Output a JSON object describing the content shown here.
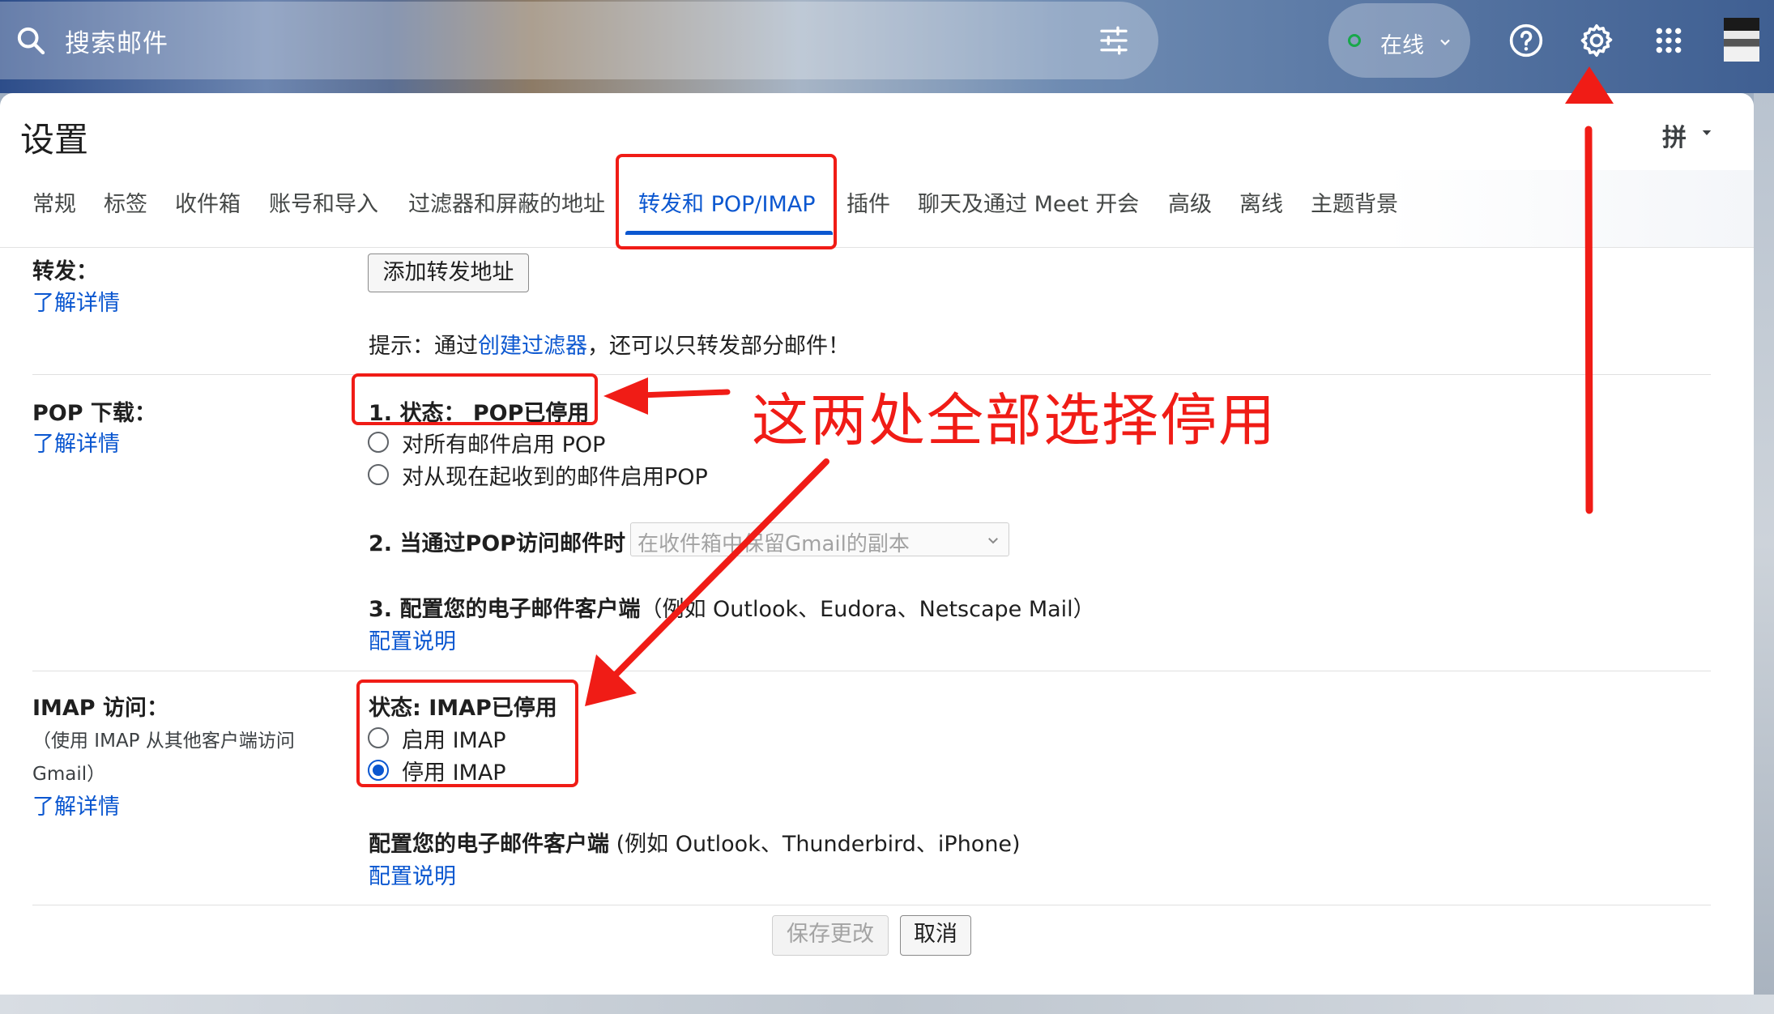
{
  "search": {
    "placeholder": "搜索邮件"
  },
  "status": {
    "label": "在线"
  },
  "header": {
    "title": "设置",
    "ime": "拼"
  },
  "tabs": [
    {
      "label": "常规"
    },
    {
      "label": "标签"
    },
    {
      "label": "收件箱"
    },
    {
      "label": "账号和导入"
    },
    {
      "label": "过滤器和屏蔽的地址"
    },
    {
      "label": "转发和 POP/IMAP",
      "active": true
    },
    {
      "label": "插件"
    },
    {
      "label": "聊天及通过 Meet 开会"
    },
    {
      "label": "高级"
    },
    {
      "label": "离线"
    },
    {
      "label": "主题背景"
    }
  ],
  "forwarding": {
    "label": "转发：",
    "learn_more": "了解详情",
    "add_button": "添加转发地址",
    "tip_prefix": "提示：通过",
    "tip_link": "创建过滤器",
    "tip_suffix": "，还可以只转发部分邮件！"
  },
  "pop": {
    "label": "POP 下载：",
    "learn_more": "了解详情",
    "status": "1. 状态： POP已停用",
    "option_all": "对所有邮件启用 POP",
    "option_all_checked": false,
    "option_from_now": "对从现在起收到的邮件启用POP",
    "option_from_now_checked": false,
    "access_label": "2. 当通过POP访问邮件时",
    "access_select": "在收件箱中保留Gmail的副本",
    "configure_label": "3. 配置您的电子邮件客户端",
    "configure_example": "（例如 Outlook、Eudora、Netscape Mail）",
    "configure_link": "配置说明"
  },
  "imap": {
    "label": "IMAP 访问：",
    "note_line1": "（使用 IMAP 从其他客户端访问",
    "note_line2": "Gmail）",
    "learn_more": "了解详情",
    "status": "状态: IMAP已停用",
    "option_enable": "启用 IMAP",
    "option_enable_checked": false,
    "option_disable": "停用 IMAP",
    "option_disable_checked": true,
    "configure_label": "配置您的电子邮件客户端",
    "configure_example": " (例如 Outlook、Thunderbird、iPhone)",
    "configure_link": "配置说明"
  },
  "footer": {
    "save_button": "保存更改",
    "cancel_button": "取消"
  },
  "annotation": {
    "text": "这两处全部选择停用",
    "color": "#f01c16"
  },
  "colors": {
    "accent": "#0b57d0",
    "online": "#18a84a",
    "annotation": "#f01c16"
  }
}
